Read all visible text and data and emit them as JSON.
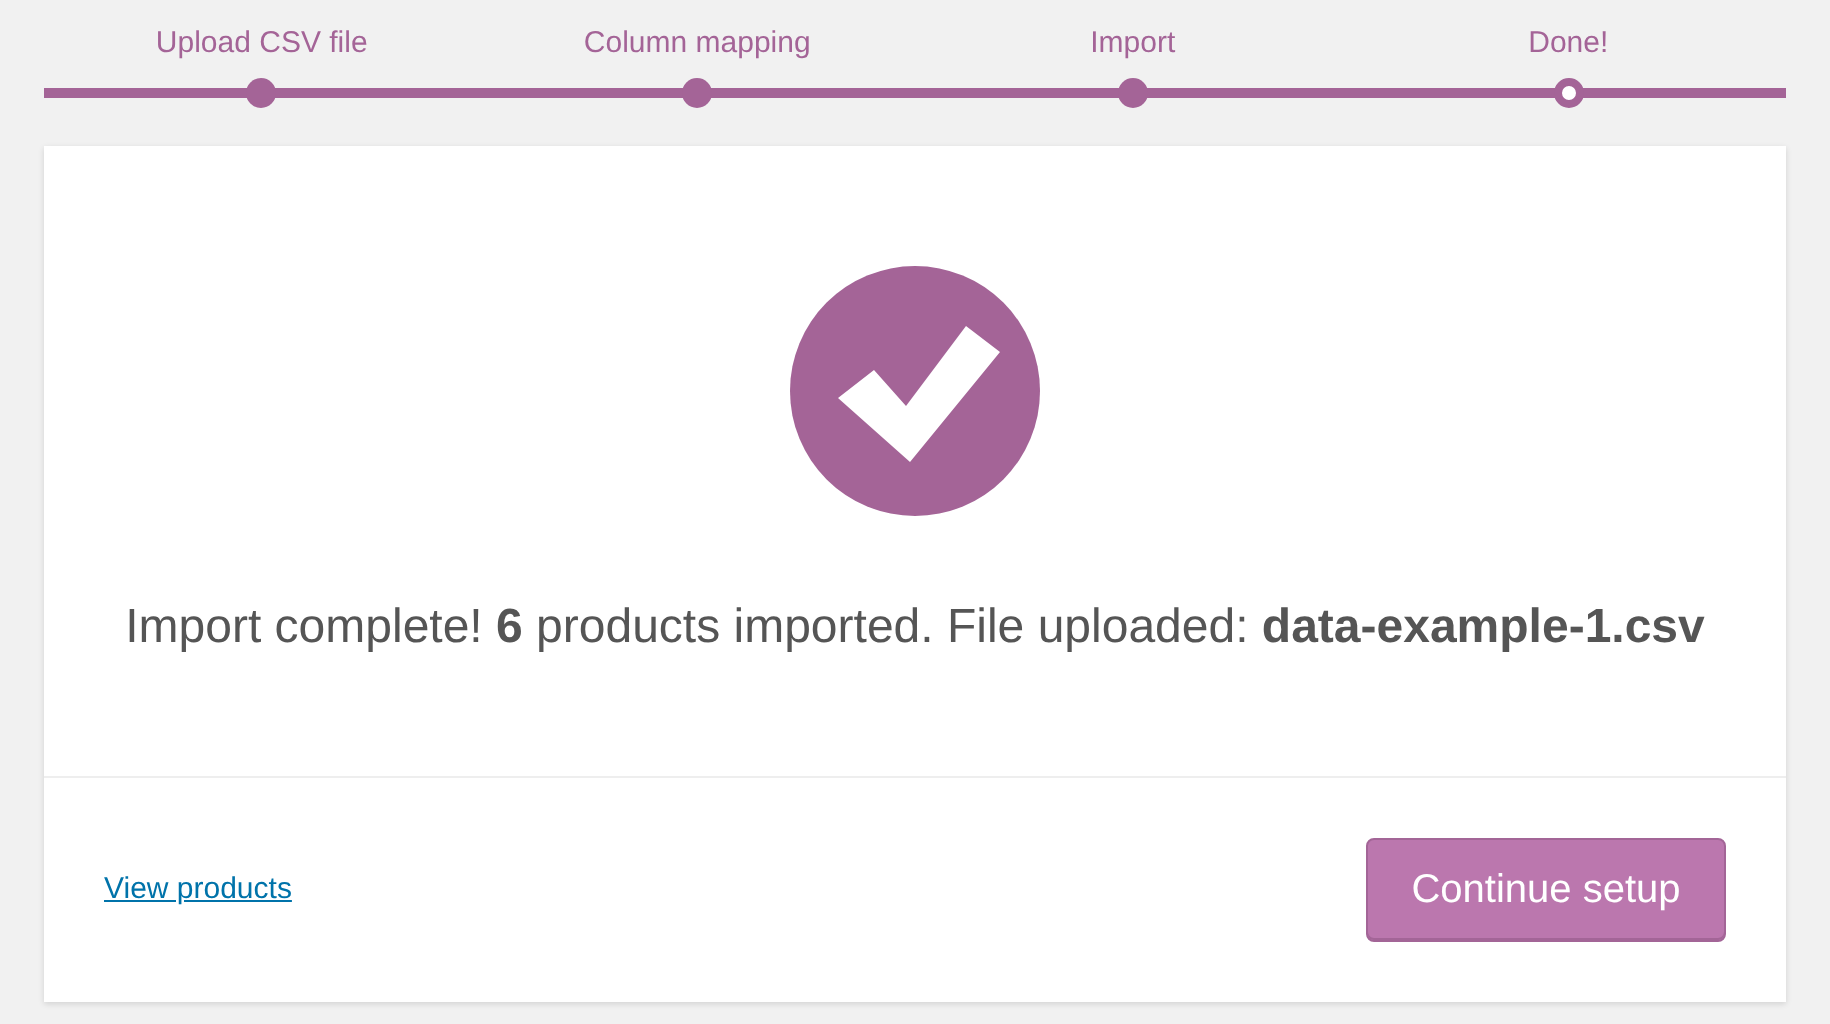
{
  "steps": [
    {
      "label": "Upload CSV file",
      "current": false
    },
    {
      "label": "Column mapping",
      "current": false
    },
    {
      "label": "Import",
      "current": false
    },
    {
      "label": "Done!",
      "current": true
    }
  ],
  "message": "Import complete! **6** products imported. File uploaded: **data-example-1.csv**",
  "footer": {
    "link": "View products",
    "button": "Continue setup"
  }
}
